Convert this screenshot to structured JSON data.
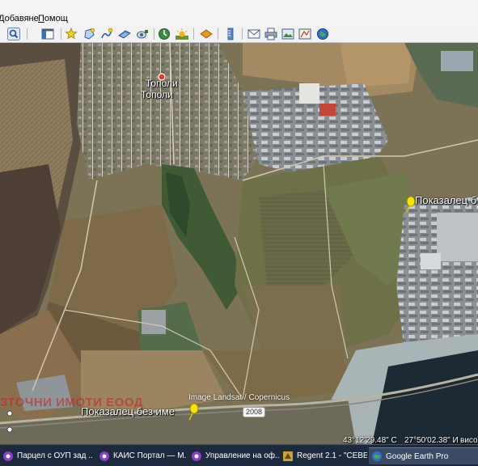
{
  "menu": {
    "items": [
      {
        "label": "Добавяне",
        "underline": "Д",
        "rest": "обавяне"
      },
      {
        "label": "Помощ",
        "underline": "П",
        "rest": "омощ"
      }
    ]
  },
  "toolbar": {
    "buttons": [
      {
        "name": "search-icon"
      },
      {
        "name": "sidebar-toggle-icon"
      },
      {
        "name": "add-placemark-icon"
      },
      {
        "name": "add-polygon-icon"
      },
      {
        "name": "add-path-icon"
      },
      {
        "name": "add-image-overlay-icon"
      },
      {
        "name": "record-tour-icon"
      },
      {
        "name": "historical-imagery-icon"
      },
      {
        "name": "sunlight-icon"
      },
      {
        "name": "switch-to-sky-icon"
      },
      {
        "name": "ruler-icon"
      },
      {
        "name": "email-icon"
      },
      {
        "name": "print-icon"
      },
      {
        "name": "save-image-icon"
      },
      {
        "name": "view-in-maps-icon"
      },
      {
        "name": "earth-icon"
      }
    ]
  },
  "map": {
    "town_label_1": "Тополи",
    "town_label_2": "Тополи",
    "placemark_right": "Показалец б",
    "placemark_bottom": "Показалец без име",
    "watermark": "ЗТОЧНИ ИМОТИ ЕООД",
    "attribution": "Image Landsat / Copernicus",
    "road_number": "2008",
    "lat": "43°12'29.48\" С",
    "lon": "27°50'02.38\" И",
    "elev": "висо"
  },
  "taskbar": {
    "tasks": [
      {
        "label": "Парцел с ОУП зад ...",
        "icon": "browser-icon",
        "active": false
      },
      {
        "label": "КАИС Портал — М...",
        "icon": "browser-icon",
        "active": false
      },
      {
        "label": "Управление на оф...",
        "icon": "browser-icon",
        "active": false
      },
      {
        "label": "Regent 2.1 - \"СЕВЕ...",
        "icon": "app-icon",
        "active": false
      },
      {
        "label": "Google Earth Pro",
        "icon": "google-earth-icon",
        "active": true
      }
    ]
  },
  "colors": {
    "pin_yellow": "#f5e400",
    "town_marker": "#e23b2b",
    "taskbar_bg": "#1d2a3d"
  }
}
